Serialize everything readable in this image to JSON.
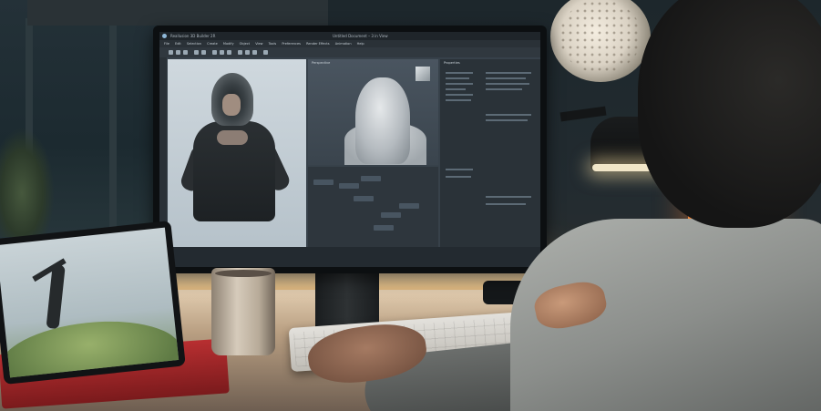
{
  "scene": {
    "description_tag": "photo",
    "colors": {
      "wall": "#1d272c",
      "desk": "#e2cdb0",
      "lamp_glow": "#f1e6c8",
      "orange_lamp": "#f0863a",
      "tablet_cover": "#b82f31"
    }
  },
  "app": {
    "window_title": "Reallusion 3D Builder 2R",
    "document_title": "Untitled Document – 3 in View",
    "menu": [
      "File",
      "Edit",
      "Selection",
      "Create",
      "Modify",
      "Object",
      "View",
      "Tools",
      "Preferences",
      "Render Effects",
      "Animation",
      "Help"
    ],
    "viewport_label": "Perspective",
    "panel_header": "Properties"
  },
  "icons": [
    "app-logo-icon",
    "heart-icon"
  ]
}
